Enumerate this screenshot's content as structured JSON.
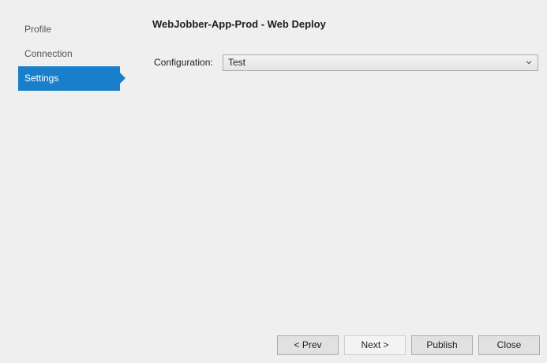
{
  "nav": {
    "items": [
      {
        "label": "Profile"
      },
      {
        "label": "Connection"
      },
      {
        "label": "Settings"
      }
    ],
    "active": "Settings"
  },
  "header": {
    "title": "WebJobber-App-Prod - Web Deploy"
  },
  "settings": {
    "configuration_label": "Configuration:",
    "configuration_value": "Test"
  },
  "footer": {
    "prev_label": "< Prev",
    "next_label": "Next >",
    "publish_label": "Publish",
    "close_label": "Close"
  },
  "colors": {
    "accent": "#1a7fcb",
    "background": "#efefef"
  },
  "icons": {
    "dropdown": "chevron-down-icon"
  }
}
